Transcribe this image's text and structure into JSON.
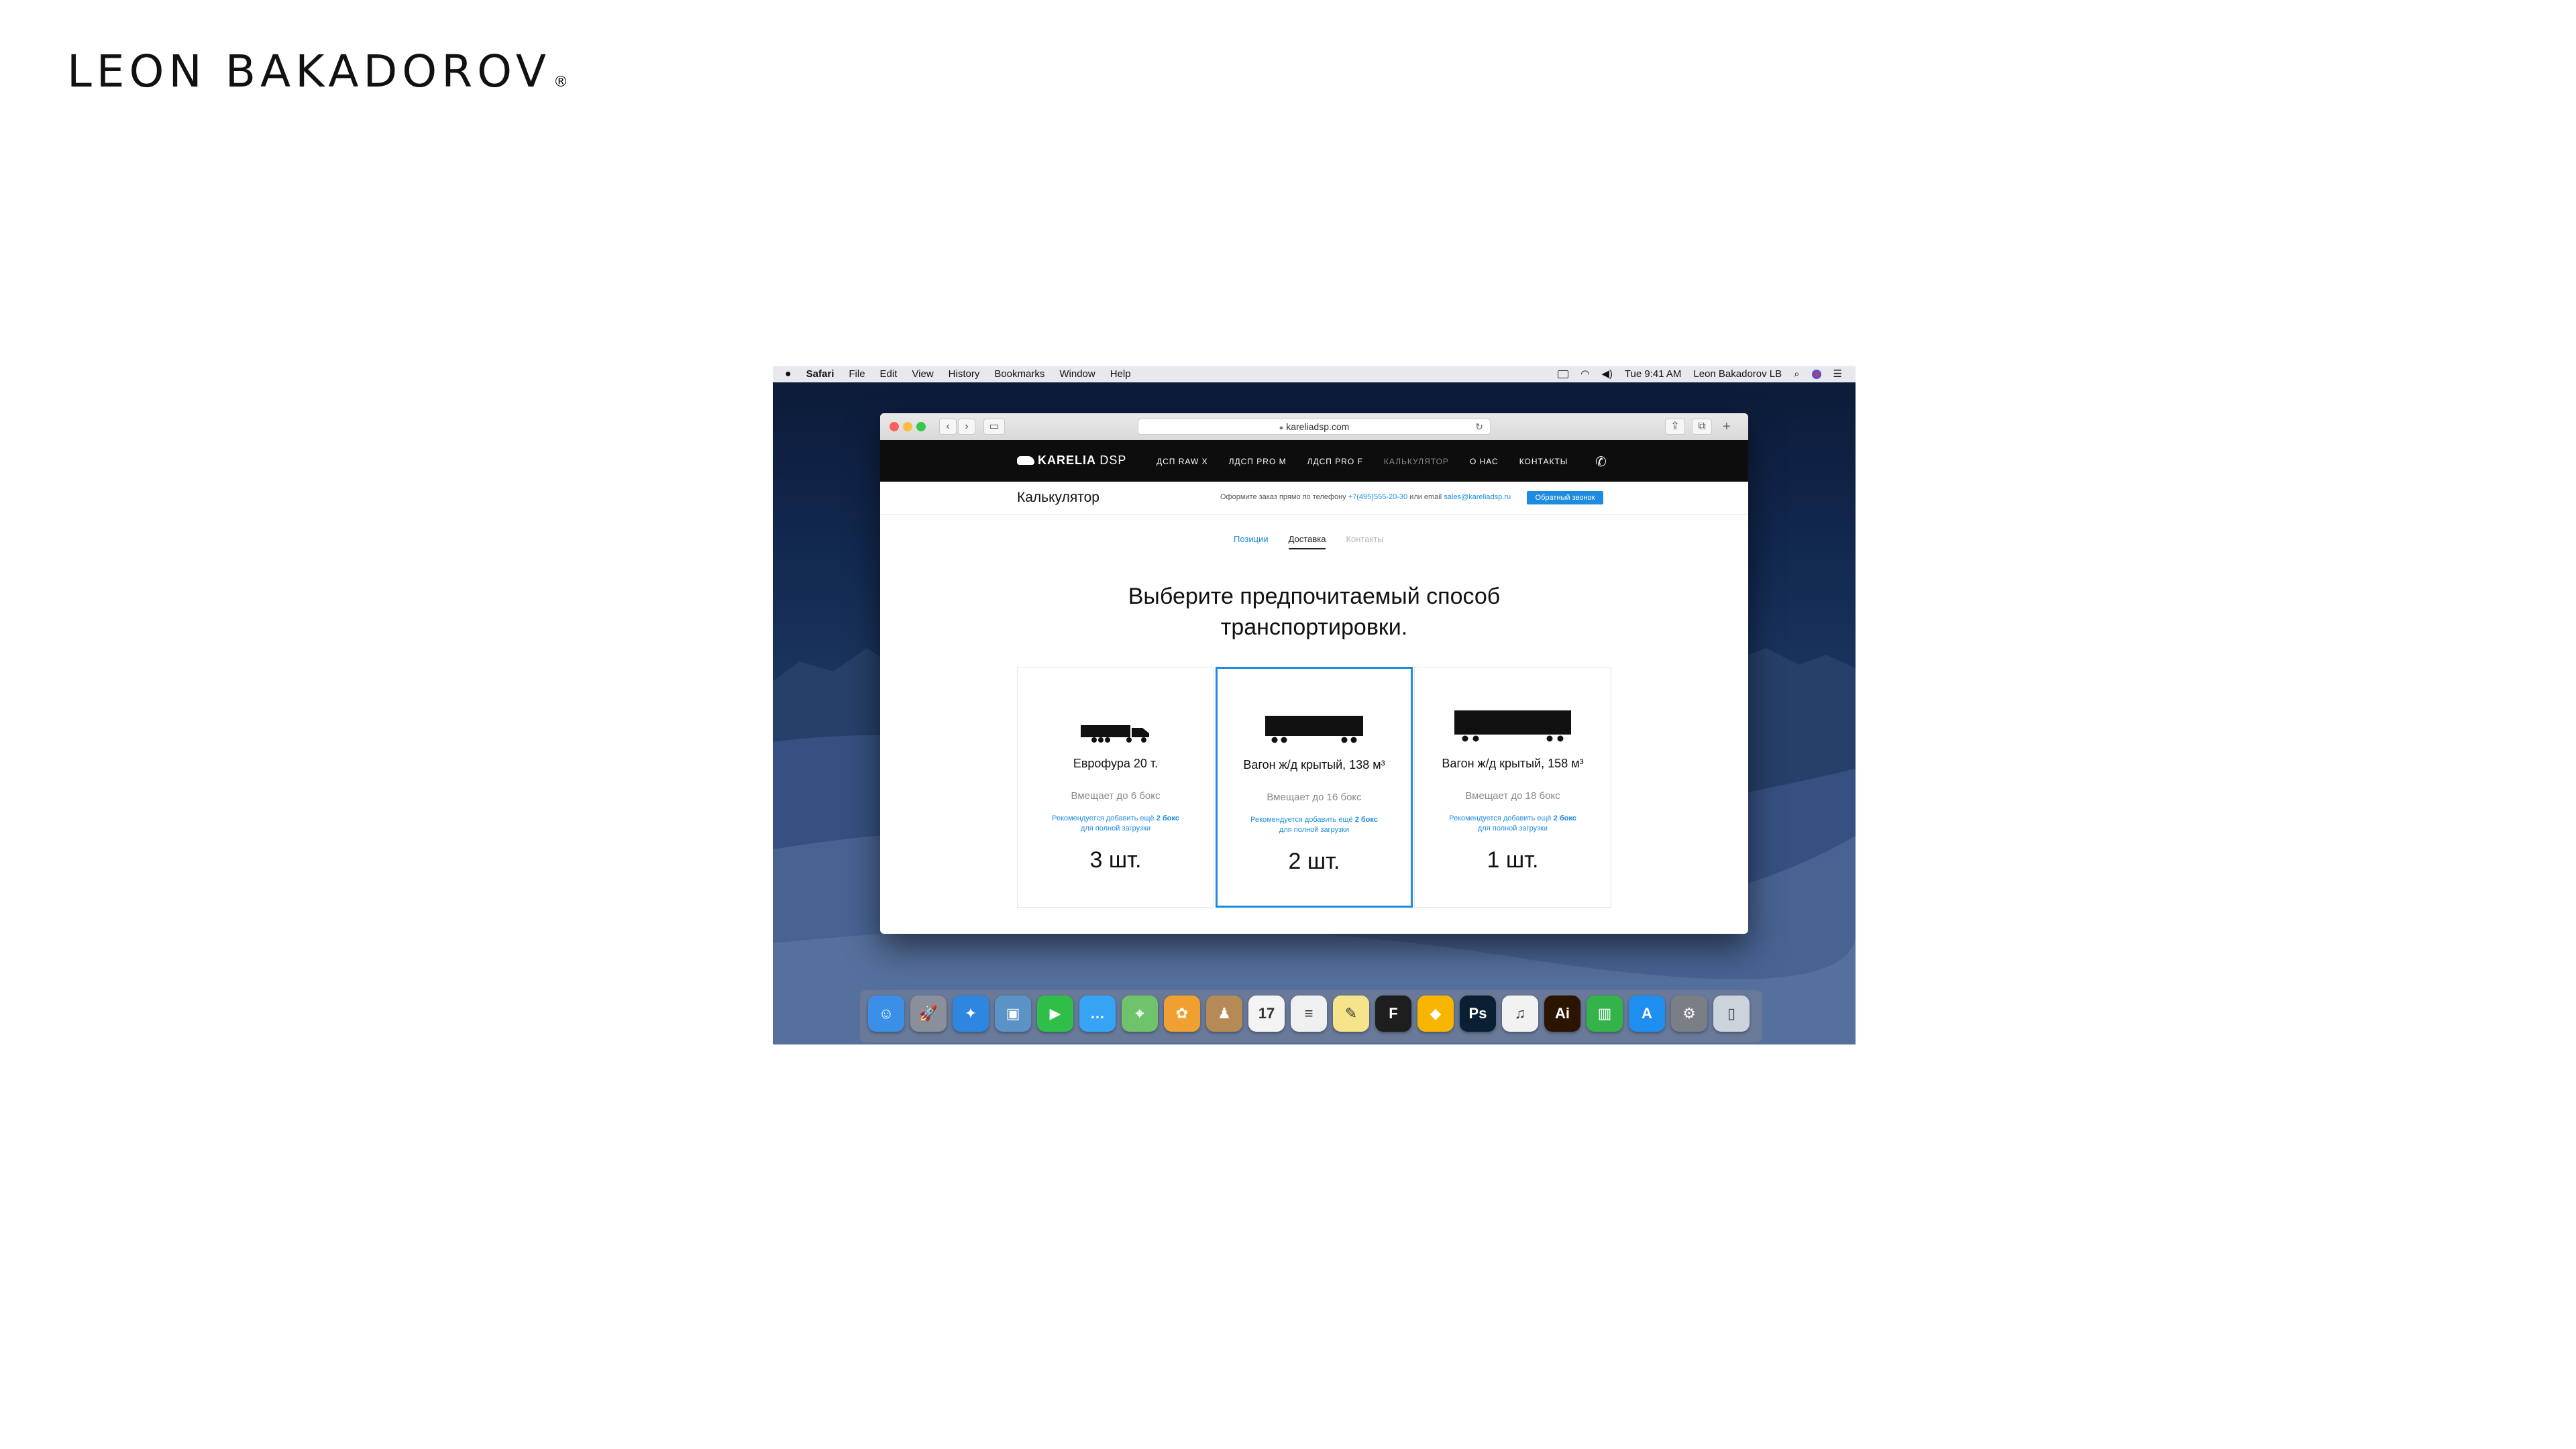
{
  "brand": {
    "name": "LEON BAKADOROV",
    "registered": "®"
  },
  "menubar": {
    "app": "Safari",
    "items": [
      "File",
      "Edit",
      "View",
      "History",
      "Bookmarks",
      "Window",
      "Help"
    ],
    "clock": "Tue 9:41 AM",
    "user": "Leon Bakadorov LB"
  },
  "browser": {
    "url": "kareliadsp.com"
  },
  "site": {
    "logo": "KARELIA",
    "logo_suffix": "DSP",
    "nav": [
      "ДСП RAW X",
      "ЛДСП PRO M",
      "ЛДСП PRO F",
      "КАЛЬКУЛЯТОР",
      "О НАС",
      "КОНТАКТЫ"
    ],
    "phone_icon": "phone-icon"
  },
  "subheader": {
    "title": "Калькулятор",
    "order_text": "Оформите заказ прямо по телефону",
    "phone": "+7(495)555-20-30",
    "email_text": "или email",
    "email": "sales@kareliadsp.ru",
    "callback": "Обратный звонок"
  },
  "tabs": [
    {
      "label": "Позиции",
      "state": "done"
    },
    {
      "label": "Доставка",
      "state": "active"
    },
    {
      "label": "Контакты",
      "state": "future"
    }
  ],
  "heading": {
    "line1": "Выберите предпочитаемый способ",
    "line2": "транспортировки."
  },
  "cards": [
    {
      "name": "Еврофура 20 т.",
      "capacity": "Вмещает до 6 бокс",
      "rec_prefix": "Рекомендуется добавить ещё",
      "rec_count": "2 бокс",
      "rec_suffix": "для полной загрузки",
      "qty": "3 шт.",
      "selected": false
    },
    {
      "name": "Вагон ж/д крытый, 138 м³",
      "capacity": "Вмещает до 16 бокс",
      "rec_prefix": "Рекомендуется добавить ещё",
      "rec_count": "2 бокс",
      "rec_suffix": "для полной загрузки",
      "qty": "2 шт.",
      "selected": true
    },
    {
      "name": "Вагон ж/д крытый, 158 м³",
      "capacity": "Вмещает до 18 бокс",
      "rec_prefix": "Рекомендуется добавить ещё",
      "rec_count": "2 бокс",
      "rec_suffix": "для полной загрузки",
      "qty": "1 шт.",
      "selected": false
    }
  ],
  "dock": [
    {
      "name": "finder-icon",
      "glyph": "☺",
      "color": "#3b8fe6"
    },
    {
      "name": "launchpad-icon",
      "glyph": "🚀",
      "color": "#8a8f99"
    },
    {
      "name": "safari-icon",
      "glyph": "✦",
      "color": "#2f86e0"
    },
    {
      "name": "preview-icon",
      "glyph": "▣",
      "color": "#5b93c7"
    },
    {
      "name": "facetime-icon",
      "glyph": "▶",
      "color": "#2fbf48"
    },
    {
      "name": "messages-icon",
      "glyph": "…",
      "color": "#37a3f5"
    },
    {
      "name": "maps-icon",
      "glyph": "⌖",
      "color": "#6fc36b"
    },
    {
      "name": "photos-icon",
      "glyph": "✿",
      "color": "#f0a030"
    },
    {
      "name": "contacts-icon",
      "glyph": "♟",
      "color": "#b58a57"
    },
    {
      "name": "calendar-icon",
      "glyph": "17",
      "color": "#f4f4f4"
    },
    {
      "name": "reminders-icon",
      "glyph": "≡",
      "color": "#f0f0f0"
    },
    {
      "name": "notes-icon",
      "glyph": "✎",
      "color": "#f6e48a"
    },
    {
      "name": "figma-icon",
      "glyph": "F",
      "color": "#1e1e1e"
    },
    {
      "name": "sketch-icon",
      "glyph": "◆",
      "color": "#f7b500"
    },
    {
      "name": "photoshop-icon",
      "glyph": "Ps",
      "color": "#0b1f33"
    },
    {
      "name": "itunes-icon",
      "glyph": "♫",
      "color": "#f2f2f2"
    },
    {
      "name": "illustrator-icon",
      "glyph": "Ai",
      "color": "#2b1400"
    },
    {
      "name": "numbers-icon",
      "glyph": "▥",
      "color": "#34b34a"
    },
    {
      "name": "app-store-icon",
      "glyph": "A",
      "color": "#1f8ef1"
    },
    {
      "name": "system-preferences-icon",
      "glyph": "⚙",
      "color": "#7a7f86"
    },
    {
      "name": "trash-icon",
      "glyph": "▯",
      "color": "#cdd3da"
    }
  ]
}
